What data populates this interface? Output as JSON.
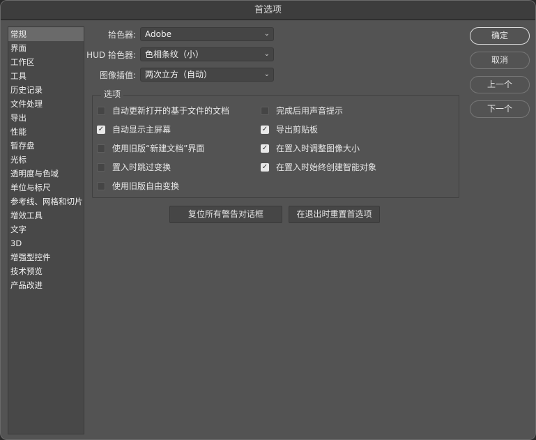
{
  "title": "首选项",
  "sidebar": {
    "items": [
      "常规",
      "界面",
      "工作区",
      "工具",
      "历史记录",
      "文件处理",
      "导出",
      "性能",
      "暂存盘",
      "光标",
      "透明度与色域",
      "单位与标尺",
      "参考线、网格和切片",
      "增效工具",
      "文字",
      "3D",
      "增强型控件",
      "技术预览",
      "产品改进"
    ],
    "selected": 0
  },
  "fields": [
    {
      "label": "拾色器:",
      "value": "Adobe"
    },
    {
      "label": "HUD 拾色器:",
      "value": "色相条纹（小）"
    },
    {
      "label": "图像插值:",
      "value": "两次立方（自动）"
    }
  ],
  "options": {
    "title": "选项",
    "items": [
      {
        "label": "自动更新打开的基于文件的文档",
        "checked": false
      },
      {
        "label": "完成后用声音提示",
        "checked": false
      },
      {
        "label": "自动显示主屏幕",
        "checked": true
      },
      {
        "label": "导出剪贴板",
        "checked": true
      },
      {
        "label": "使用旧版“新建文档”界面",
        "checked": false
      },
      {
        "label": "在置入时调整图像大小",
        "checked": true
      },
      {
        "label": "置入时跳过变换",
        "checked": false
      },
      {
        "label": "在置入时始终创建智能对象",
        "checked": true
      },
      {
        "label": "使用旧版自由变换",
        "checked": false
      }
    ]
  },
  "buttons": {
    "reset_warnings": "复位所有警告对话框",
    "reset_prefs": "在退出时重置首选项",
    "ok": "确定",
    "cancel": "取消",
    "prev": "上一个",
    "next": "下一个"
  }
}
